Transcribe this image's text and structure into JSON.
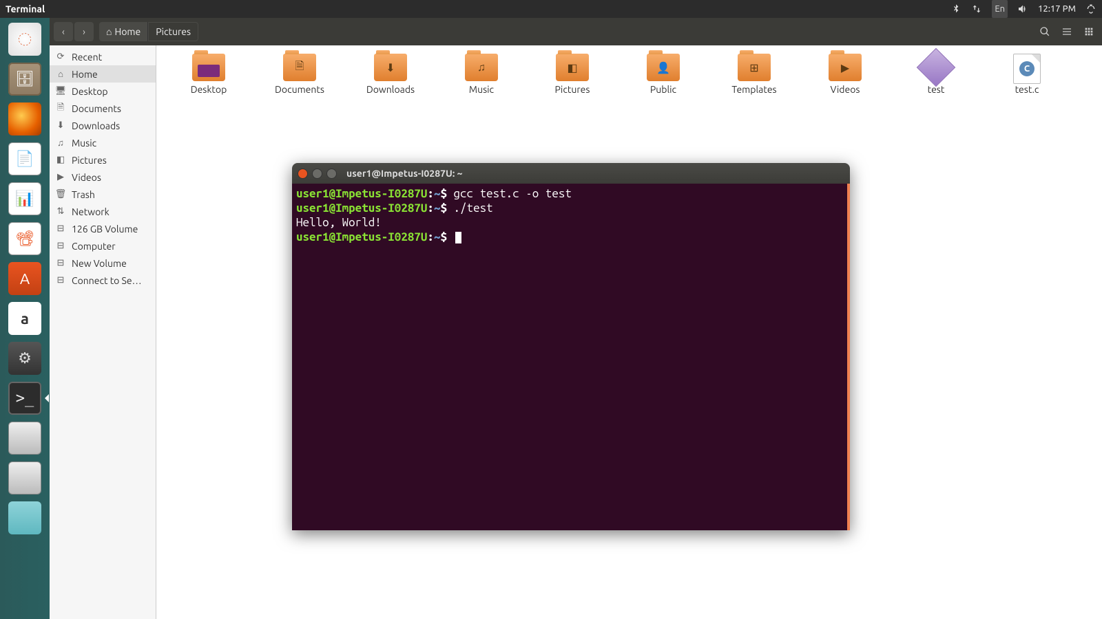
{
  "menubar": {
    "app": "Terminal",
    "lang": "En",
    "time": "12:17 PM"
  },
  "launcher": [
    {
      "name": "dash",
      "cls": "ic-ubuntu",
      "glyph": "◌"
    },
    {
      "name": "files",
      "cls": "ic-files",
      "glyph": "🗄"
    },
    {
      "name": "firefox",
      "cls": "ic-firefox",
      "glyph": ""
    },
    {
      "name": "writer",
      "cls": "ic-writer",
      "glyph": "📄"
    },
    {
      "name": "calc",
      "cls": "ic-calc",
      "glyph": "📊"
    },
    {
      "name": "impress",
      "cls": "ic-impress",
      "glyph": "📽"
    },
    {
      "name": "software",
      "cls": "ic-software",
      "glyph": "A"
    },
    {
      "name": "amazon",
      "cls": "ic-amazon",
      "glyph": "a"
    },
    {
      "name": "settings",
      "cls": "ic-settings",
      "glyph": "⚙"
    },
    {
      "name": "terminal",
      "cls": "ic-terminal",
      "glyph": ">_",
      "active": true
    },
    {
      "name": "drive1",
      "cls": "ic-drive",
      "glyph": ""
    },
    {
      "name": "drive2",
      "cls": "ic-drive",
      "glyph": ""
    },
    {
      "name": "trash",
      "cls": "ic-trash",
      "glyph": ""
    }
  ],
  "pathbar": {
    "seg1": "Home",
    "seg2": "Pictures"
  },
  "sidebar": [
    {
      "icon": "⟳",
      "label": "Recent"
    },
    {
      "icon": "⌂",
      "label": "Home",
      "sel": true
    },
    {
      "icon": "🖥",
      "label": "Desktop"
    },
    {
      "icon": "🗎",
      "label": "Documents"
    },
    {
      "icon": "⬇",
      "label": "Downloads"
    },
    {
      "icon": "♫",
      "label": "Music"
    },
    {
      "icon": "◧",
      "label": "Pictures"
    },
    {
      "icon": "▶",
      "label": "Videos"
    },
    {
      "icon": "🗑",
      "label": "Trash"
    },
    {
      "icon": "⇅",
      "label": "Network"
    },
    {
      "icon": "⊟",
      "label": "126 GB Volume"
    },
    {
      "icon": "⊟",
      "label": "Computer"
    },
    {
      "icon": "⊟",
      "label": "New Volume"
    },
    {
      "icon": "⊟",
      "label": "Connect to Se…"
    }
  ],
  "files": [
    {
      "name": "Desktop",
      "type": "folder",
      "variant": "desktop"
    },
    {
      "name": "Documents",
      "type": "folder",
      "overlay": "🗎"
    },
    {
      "name": "Downloads",
      "type": "folder",
      "overlay": "⬇"
    },
    {
      "name": "Music",
      "type": "folder",
      "overlay": "♫"
    },
    {
      "name": "Pictures",
      "type": "folder",
      "overlay": "◧"
    },
    {
      "name": "Public",
      "type": "folder",
      "overlay": "👤"
    },
    {
      "name": "Templates",
      "type": "folder",
      "overlay": "⊞"
    },
    {
      "name": "Videos",
      "type": "folder",
      "overlay": "▶"
    },
    {
      "name": "test",
      "type": "diamond"
    },
    {
      "name": "test.c",
      "type": "cfile"
    }
  ],
  "terminal": {
    "title": "user1@Impetus-I0287U: ~",
    "lines": [
      {
        "user": "user1@Impetus-I0287U",
        "path": "~",
        "cmd": "gcc test.c -o test"
      },
      {
        "user": "user1@Impetus-I0287U",
        "path": "~",
        "cmd": "./test"
      },
      {
        "out": "Hello, World!"
      },
      {
        "user": "user1@Impetus-I0287U",
        "path": "~",
        "cmd": "",
        "cursor": true
      }
    ]
  }
}
